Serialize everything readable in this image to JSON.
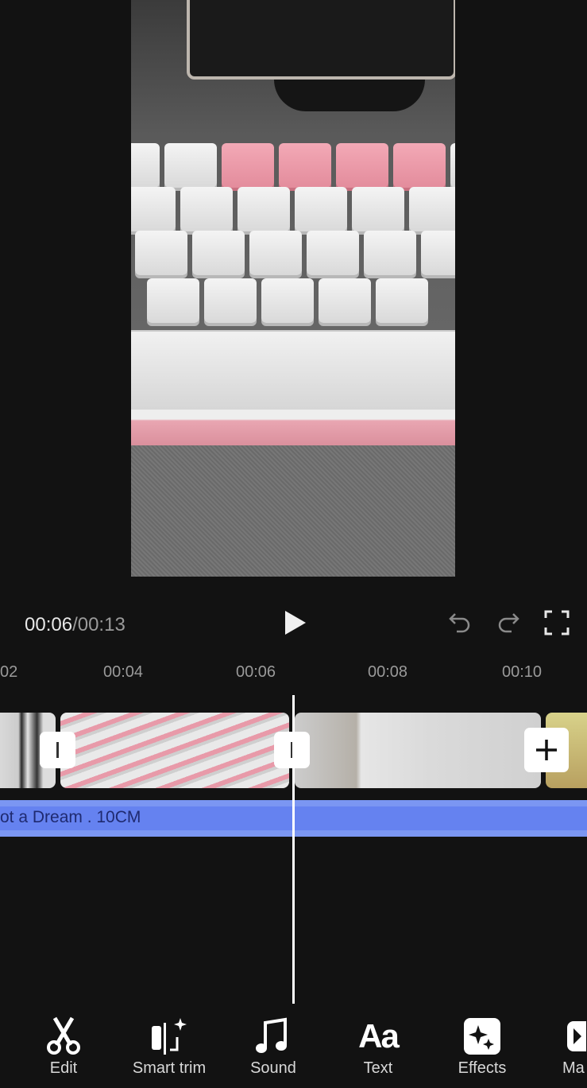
{
  "player": {
    "current_time": "00:06",
    "separator": "/",
    "total_time": "00:13"
  },
  "timeline": {
    "ticks": [
      "02",
      "00:04",
      "00:06",
      "00:08",
      "00:10"
    ],
    "audio_track": "ot a Dream . 10CM",
    "playhead_time": "00:06"
  },
  "toolbar": {
    "items": [
      {
        "label": "Edit",
        "icon": "scissors-icon"
      },
      {
        "label": "Smart trim",
        "icon": "smart-trim-icon"
      },
      {
        "label": "Sound",
        "icon": "music-note-icon"
      },
      {
        "label": "Text",
        "icon": "text-aa-icon",
        "glyph": "Aa"
      },
      {
        "label": "Effects",
        "icon": "sparkle-icon"
      },
      {
        "label": "Ma",
        "icon": "play-box-icon"
      }
    ]
  },
  "colors": {
    "background": "#121212",
    "audio": "#7b96f2",
    "audio_text": "#1f2a70"
  }
}
